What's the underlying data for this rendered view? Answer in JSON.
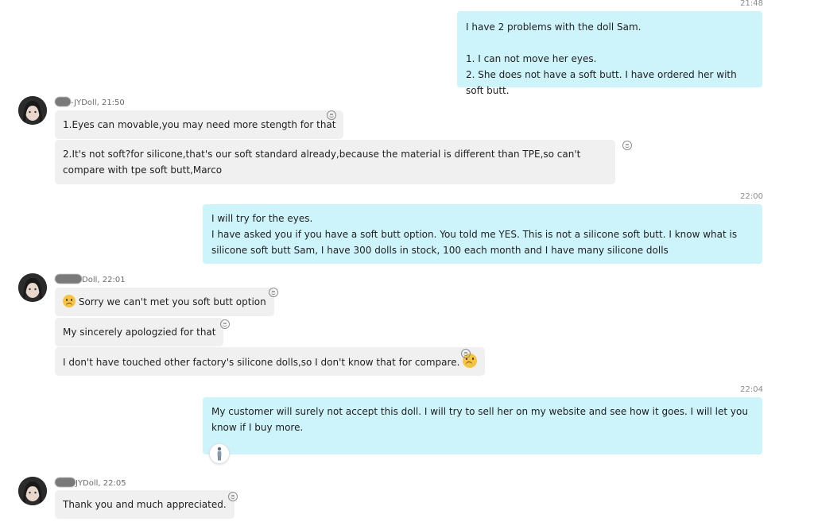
{
  "messages": [
    {
      "id": "m1",
      "direction": "outgoing",
      "time": "21:48",
      "lines": [
        "I have 2 problems with the doll Sam.",
        "",
        "1. I can not move her eyes.",
        "2. She does not have a soft butt. I have ordered her with soft butt."
      ]
    },
    {
      "id": "g1",
      "direction": "incoming",
      "sender": "-JYDoll, 21:50",
      "bubbles": [
        "1.Eyes can movable,you may need more stength for that",
        "2.It's not soft?for silicone,that's our soft standard already,because the material is different than TPE,so can't compare with tpe soft butt,Marco"
      ]
    },
    {
      "id": "m2",
      "direction": "outgoing",
      "time": "22:00",
      "lines": [
        "I will try for the eyes.",
        "I have asked you if you have a soft butt option. You told me YES. This is not a silicone soft butt. I know what is silicone soft butt Sam, I have 300 dolls in stock, 100 each month and I have many silicone dolls"
      ]
    },
    {
      "id": "g2",
      "direction": "incoming",
      "sender": "Doll, 22:01",
      "bubbles": [
        "Sorry we can't met you soft butt option",
        "My sincerely apologzied for that",
        "I don't have touched other factory's silicone dolls,so I don't know that for compare."
      ]
    },
    {
      "id": "m3",
      "direction": "outgoing",
      "time": "22:04",
      "lines": [
        "My customer will surely not accept this doll. I will try to sell her on my website and see how it goes. I will let you know if I buy more."
      ],
      "reaction": "person-icon"
    },
    {
      "id": "g3",
      "direction": "incoming",
      "sender": "JYDoll, 22:05",
      "bubbles": [
        "Thank you and much appreciated."
      ]
    }
  ],
  "icons": {
    "reaction_button": "smiley-icon",
    "sad_emoji": "sad-face-emoji",
    "avatar": "contact-avatar"
  },
  "colors": {
    "outgoing_bubble": "#cdf3fb",
    "incoming_bubble": "#f0f0f0"
  }
}
